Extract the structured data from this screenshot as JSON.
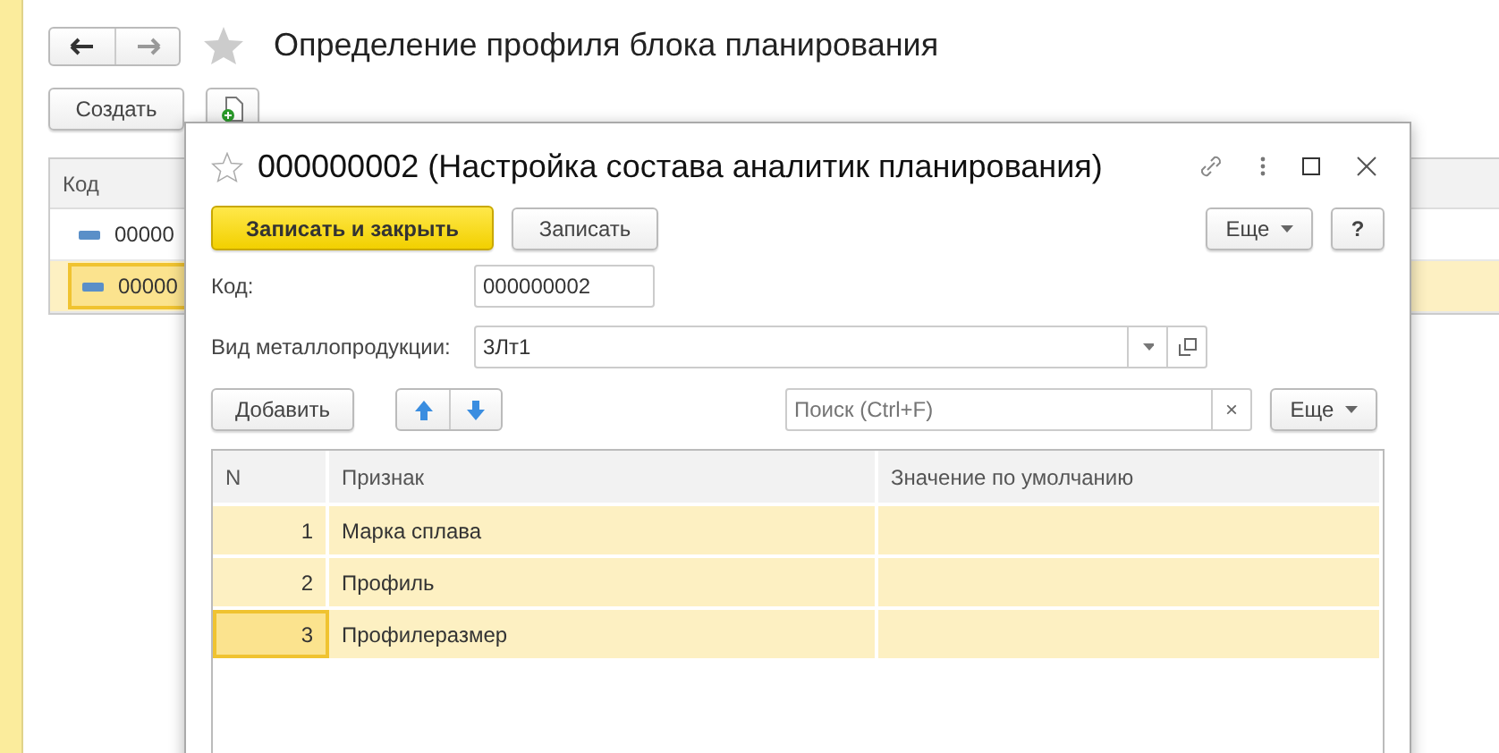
{
  "page": {
    "title": "Определение профиля блока планирования",
    "create_button": "Создать",
    "table": {
      "columns": [
        "Код"
      ],
      "rows": [
        {
          "code": "00000",
          "selected": false
        },
        {
          "code": "00000",
          "selected": true
        }
      ]
    }
  },
  "dialog": {
    "title": "000000002 (Настройка состава аналитик планирования)",
    "buttons": {
      "save_close": "Записать и закрыть",
      "save": "Записать",
      "more": "Еще",
      "help": "?"
    },
    "fields": [
      {
        "label": "Код:",
        "value": "000000002",
        "kind": "text"
      },
      {
        "label": "Вид металлопродукции:",
        "value": "3Лт1",
        "kind": "select"
      }
    ],
    "toolbar": {
      "add": "Добавить",
      "search_placeholder": "Поиск (Ctrl+F)",
      "clear": "×",
      "more": "Еще"
    },
    "table": {
      "columns": [
        "N",
        "Признак",
        "Значение по умолчанию"
      ],
      "rows": [
        {
          "n": "1",
          "attribute": "Марка сплава",
          "selected": false
        },
        {
          "n": "2",
          "attribute": "Профиль",
          "selected": false
        },
        {
          "n": "3",
          "attribute": "Профилеразмер",
          "selected": true
        }
      ]
    }
  }
}
